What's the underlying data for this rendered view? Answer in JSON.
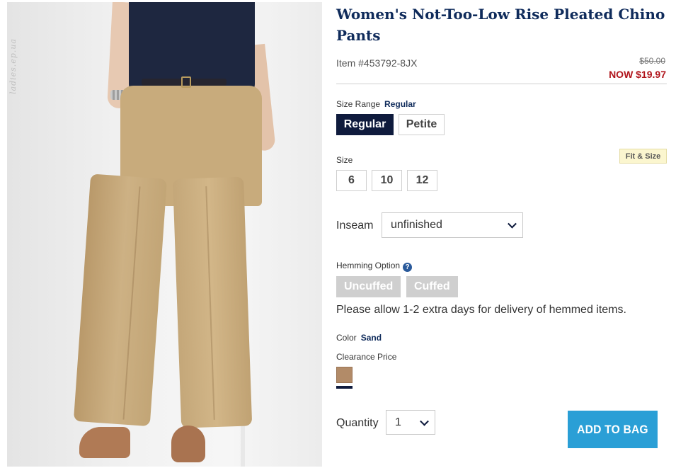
{
  "product": {
    "title": "Women's Not-Too-Low Rise Pleated Chino Pants",
    "item_number": "Item #453792-8JX",
    "price_was": "$50.00",
    "price_now": "NOW $19.97"
  },
  "photo": {
    "watermark": "ladies.ep.ua"
  },
  "size_range": {
    "label": "Size Range",
    "selected": "Regular",
    "options": [
      "Regular",
      "Petite"
    ]
  },
  "size": {
    "label": "Size",
    "options": [
      "6",
      "10",
      "12"
    ],
    "fit_link": "Fit & Size"
  },
  "inseam": {
    "label": "Inseam",
    "value": "unfinished"
  },
  "hemming": {
    "label": "Hemming Option",
    "help_icon": "question-circle-icon",
    "options": [
      "Uncuffed",
      "Cuffed"
    ],
    "note": "Please allow 1-2 extra days for delivery of hemmed items."
  },
  "color": {
    "label": "Color",
    "selected": "Sand",
    "price_note": "Clearance Price",
    "swatch_color": "#b28b68"
  },
  "quantity": {
    "label": "Quantity",
    "value": "1"
  },
  "cta": {
    "add_to_bag": "ADD TO BAG",
    "color": "#2a9fd6"
  }
}
